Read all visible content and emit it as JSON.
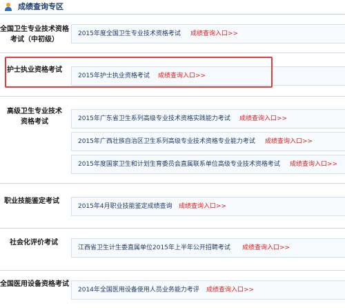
{
  "header": {
    "title": "成绩查询专区",
    "icon": "user-icon"
  },
  "link_label": "成绩查询入口>>",
  "sections": [
    {
      "category": [
        "全国卫生专业技术资格",
        "考试（中初级）"
      ],
      "exams": [
        "2015年度全国卫生专业技术资格考试"
      ]
    },
    {
      "category": [
        "护士执业资格考试"
      ],
      "exams": [
        "2015年护士执业资格考试"
      ]
    },
    {
      "category": [
        "高级卫生专业技术",
        "资格考试"
      ],
      "exams": [
        "2015年广东省卫生系列高级专业技术资格实践能力考试",
        "2015年广西壮族自治区卫生系列高级专业技术资格专业能力考试",
        "2015年度国家卫生和计划生育委员会直属联系单位高级专业技术资格考试"
      ]
    },
    {
      "category": [
        "职业技能鉴定考试"
      ],
      "exams": [
        "2015年4月职业技能鉴定成绩查询"
      ]
    },
    {
      "category": [
        "社会化评价考试"
      ],
      "exams": [
        "江西省卫生计生委直属单位2015年上半年公开招聘考试"
      ]
    },
    {
      "category": [
        "全国医用设备资格考试"
      ],
      "exams": [
        "2014年全国医用设备使用人员业务能力考评"
      ]
    }
  ],
  "colors": {
    "link": "#e02020",
    "highlight": "#e23b3b",
    "title": "#1c3d6e"
  }
}
